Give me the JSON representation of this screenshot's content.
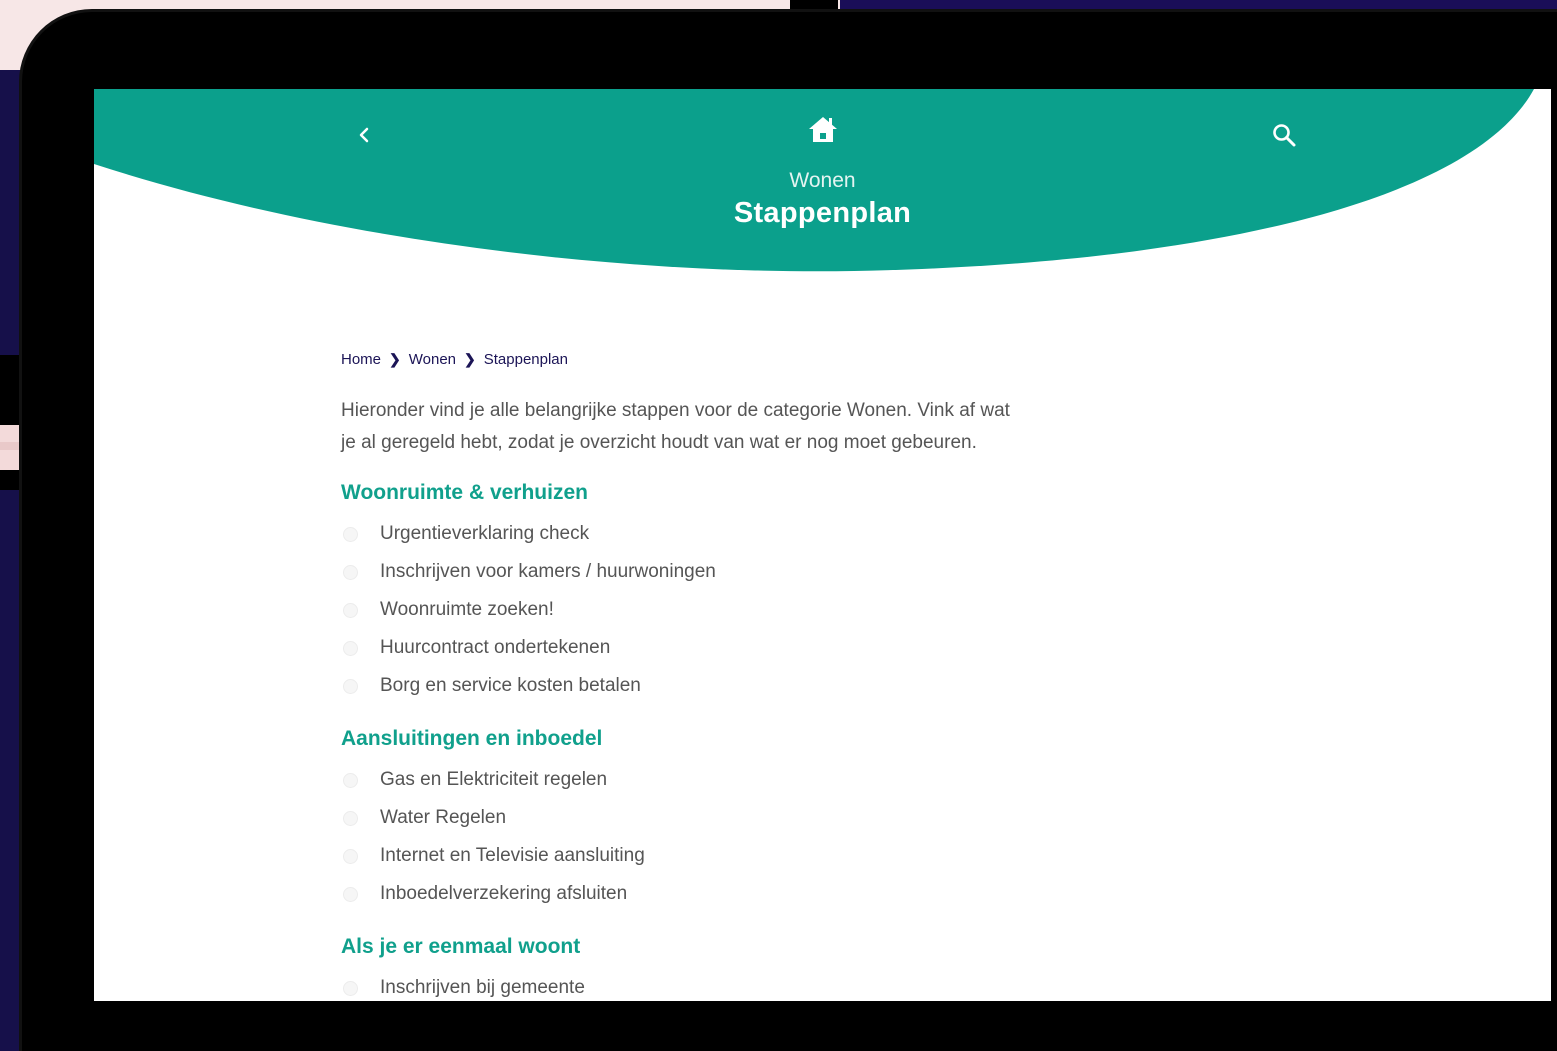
{
  "header": {
    "category": "Wonen",
    "title": "Stappenplan",
    "back_icon": "chevron-left-icon",
    "home_icon": "home-icon",
    "search_icon": "search-icon",
    "color": "#0ba08c"
  },
  "breadcrumb": {
    "items": [
      "Home",
      "Wonen",
      "Stappenplan"
    ]
  },
  "intro": "Hieronder vind je alle belangrijke stappen voor de categorie Wonen. Vink af wat je al geregeld hebt, zodat je overzicht houdt van wat er nog moet gebeuren.",
  "sections": [
    {
      "title": "Woonruimte & verhuizen",
      "steps": [
        "Urgentieverklaring check",
        "Inschrijven voor kamers / huurwoningen",
        "Woonruimte zoeken!",
        "Huurcontract ondertekenen",
        "Borg en service kosten betalen"
      ]
    },
    {
      "title": "Aansluitingen en inboedel",
      "steps": [
        "Gas en Elektriciteit regelen",
        "Water Regelen",
        "Internet en Televisie aansluiting",
        "Inboedelverzekering afsluiten"
      ]
    },
    {
      "title": "Als je er eenmaal woont",
      "steps": [
        "Inschrijven bij gemeente"
      ]
    }
  ],
  "colors": {
    "accent": "#10a08c",
    "breadcrumb": "#1b1456",
    "text": "#555555"
  }
}
